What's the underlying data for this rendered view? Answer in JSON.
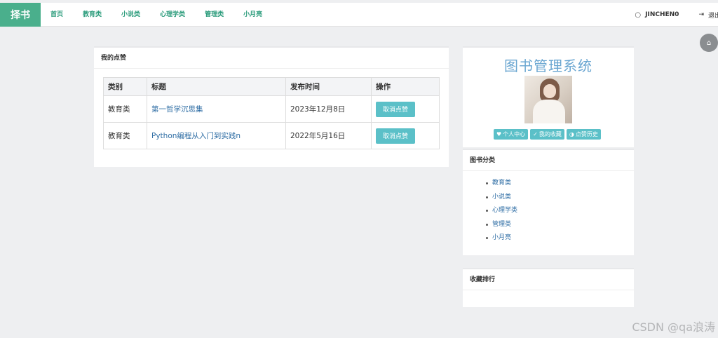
{
  "navbar": {
    "brand": "择书",
    "links": [
      "首页",
      "教育类",
      "小说类",
      "心理学类",
      "管理类",
      "小月亮"
    ],
    "user": "JINCHEN0",
    "logout": "退出"
  },
  "likes_panel": {
    "title": "我的点赞",
    "columns": [
      "类别",
      "标题",
      "发布时间",
      "操作"
    ],
    "rows": [
      {
        "category": "教育类",
        "title": "第一哲学沉思集",
        "date": "2023年12月8日",
        "action": "取消点赞"
      },
      {
        "category": "教育类",
        "title": "Python编程从入门到实践n",
        "date": "2022年5月16日",
        "action": "取消点赞"
      }
    ]
  },
  "sys_panel": {
    "title": "图书管理系统",
    "buttons": [
      "个人中心",
      "我的收藏",
      "点赞历史"
    ]
  },
  "category_panel": {
    "title": "图书分类",
    "items": [
      "教育类",
      "小说类",
      "心理学类",
      "管理类",
      "小月亮"
    ]
  },
  "rank_panel": {
    "title": "收藏排行"
  },
  "watermark": "CSDN @qa浪涛",
  "colors": {
    "brand": "#4aaf8c",
    "nav_link": "#2c9c7c",
    "button": "#5bc0c8",
    "link": "#2e6da4",
    "system_title": "#6aa6d1"
  }
}
